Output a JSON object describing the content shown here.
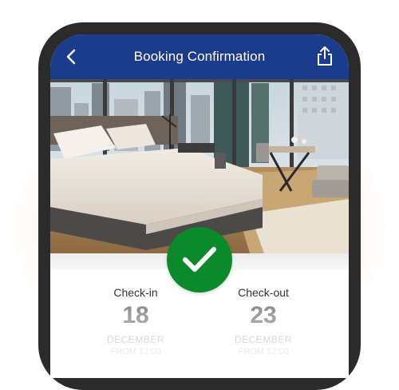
{
  "header": {
    "title": "Booking Confirmation",
    "back_icon": "chevron-left-icon",
    "share_icon": "share-icon"
  },
  "hero": {
    "image_subject": "hotel room with bed and city view"
  },
  "status": {
    "icon": "checkmark-icon",
    "color": "#0b8a2c"
  },
  "checkin": {
    "label": "Check-in",
    "day": "18",
    "month": "DECEMBER",
    "time": "FROM 12:00"
  },
  "checkout": {
    "label": "Check-out",
    "day": "23",
    "month": "DECEMBER",
    "time": "FROM 12:00"
  },
  "colors": {
    "header_bg": "#1b3c8c",
    "phone_frame": "#2b2b2b",
    "success": "#0b8a2c"
  }
}
